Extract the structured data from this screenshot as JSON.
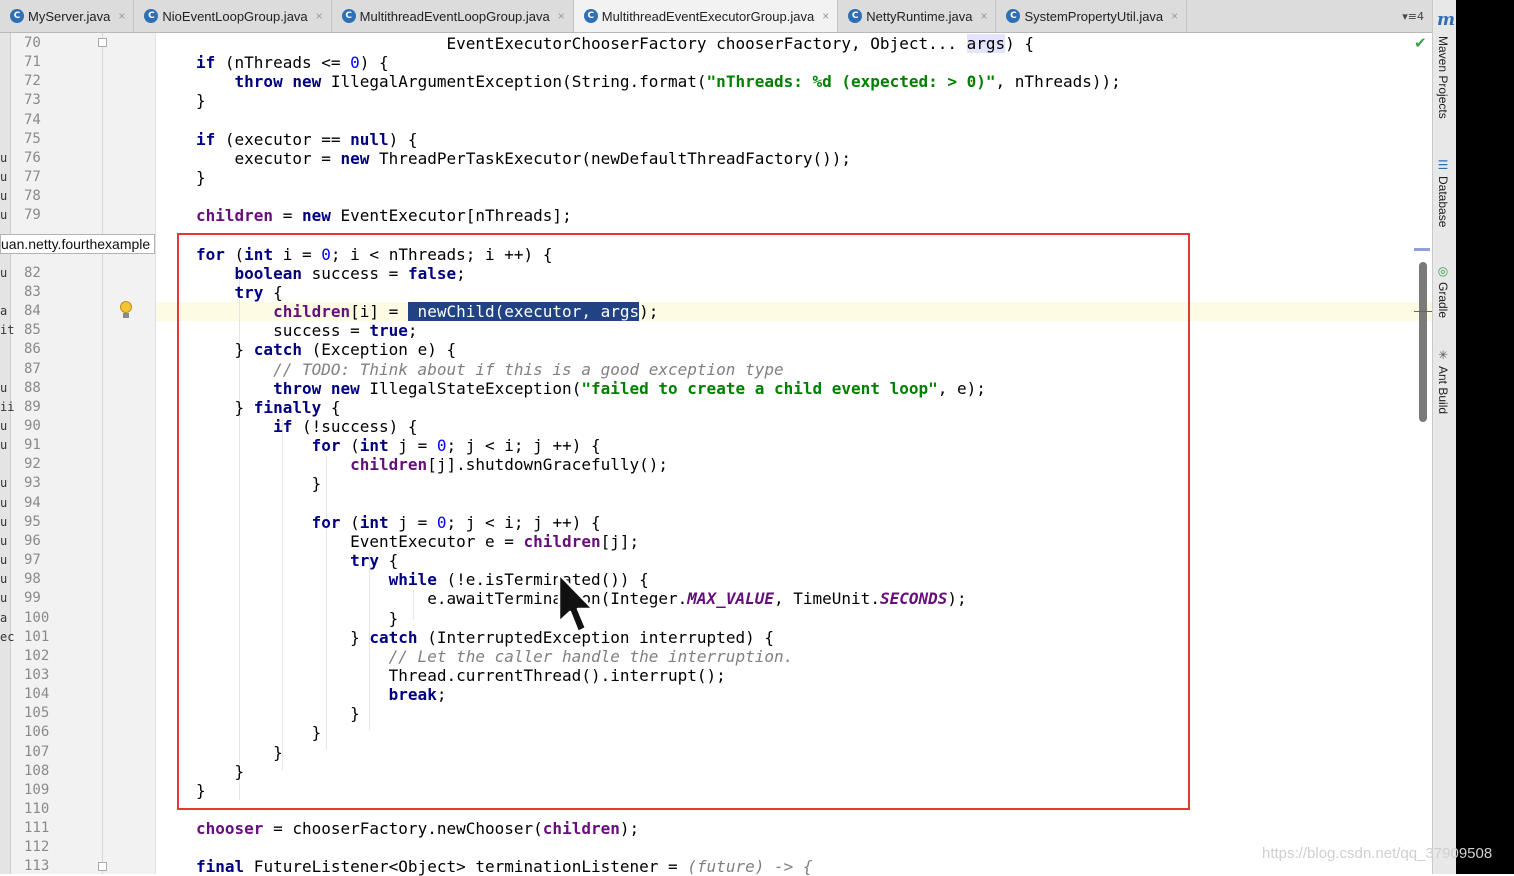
{
  "tabs": [
    {
      "label": "MyServer.java",
      "icon": "class-file-icon",
      "active": false
    },
    {
      "label": "NioEventLoopGroup.java",
      "icon": "class-file-icon",
      "active": false
    },
    {
      "label": "MultithreadEventLoopGroup.java",
      "icon": "class-file-icon",
      "active": false
    },
    {
      "label": "MultithreadEventExecutorGroup.java",
      "icon": "class-file-icon",
      "active": true
    },
    {
      "label": "NettyRuntime.java",
      "icon": "class-file-icon",
      "active": false
    },
    {
      "label": "SystemPropertyUtil.java",
      "icon": "class-file-icon",
      "active": false
    }
  ],
  "tab_overflow": "4",
  "tool_windows": [
    "Maven Projects",
    "Database",
    "Gradle",
    "Ant Build"
  ],
  "package_tooltip": "uan.netty.fourthexample",
  "gutter_left_chars": {
    "76": "u",
    "77": "u",
    "78": "u",
    "79": "u",
    "82": "u",
    "84": "a",
    "85": "it",
    "88": "u",
    "89": "ii",
    "90": "u",
    "91": "u",
    "93": "u",
    "94": "u",
    "95": "u",
    "96": "u",
    "97": "u",
    "98": "u",
    "99": "u",
    "100": "a",
    "101": "ec"
  },
  "code_lines": [
    {
      "n": "70",
      "html": "                          EventExecutorChooserFactory chooserFactory, Object... <span class=\"argsbg\">args</span>) {"
    },
    {
      "n": "71",
      "html": "<span class=\"kw\">if</span> (nThreads &lt;= <span class=\"num\">0</span>) {"
    },
    {
      "n": "72",
      "html": "    <span class=\"kw\">throw new</span> IllegalArgumentException(String.format(<span class=\"str\">\"nThreads: %d (expected: &gt; 0)\"</span>, nThreads));"
    },
    {
      "n": "73",
      "html": "}"
    },
    {
      "n": "74",
      "html": ""
    },
    {
      "n": "75",
      "html": "<span class=\"kw\">if</span> (executor == <span class=\"kw\">null</span>) {"
    },
    {
      "n": "76",
      "html": "    executor = <span class=\"kw\">new</span> ThreadPerTaskExecutor(newDefaultThreadFactory());"
    },
    {
      "n": "77",
      "html": "}"
    },
    {
      "n": "78",
      "html": ""
    },
    {
      "n": "79",
      "html": "<span class=\"fld\">children</span> = <span class=\"kw\">new</span> EventExecutor[nThreads];"
    },
    {
      "n": "",
      "html": ""
    },
    {
      "n": "",
      "html": "<span class=\"kw\">for</span> (<span class=\"kw\">int</span> i = <span class=\"num\">0</span>; i &lt; nThreads; i ++) {"
    },
    {
      "n": "82",
      "html": "    <span class=\"kw\">boolean</span> success = <span class=\"kw\">false</span>;"
    },
    {
      "n": "83",
      "html": "    <span class=\"kw\">try</span> {"
    },
    {
      "n": "84",
      "html": "        <span class=\"fld\">children</span>[i] = <span class=\"sel\"> newChild(executor, args</span>);"
    },
    {
      "n": "85",
      "html": "        success = <span class=\"kw\">true</span>;"
    },
    {
      "n": "86",
      "html": "    } <span class=\"kw\">catch</span> (Exception e) {"
    },
    {
      "n": "87",
      "html": "        <span class=\"cm\">// TODO: Think about if this is a good exception type</span>"
    },
    {
      "n": "88",
      "html": "        <span class=\"kw\">throw new</span> IllegalStateException(<span class=\"str\">\"failed to create a child event loop\"</span>, e);"
    },
    {
      "n": "89",
      "html": "    } <span class=\"kw\">finally</span> {"
    },
    {
      "n": "90",
      "html": "        <span class=\"kw\">if</span> (!success) {"
    },
    {
      "n": "91",
      "html": "            <span class=\"kw\">for</span> (<span class=\"kw\">int</span> j = <span class=\"num\">0</span>; j &lt; i; j ++) {"
    },
    {
      "n": "92",
      "html": "                <span class=\"fld\">children</span>[j].shutdownGracefully();"
    },
    {
      "n": "93",
      "html": "            }"
    },
    {
      "n": "94",
      "html": ""
    },
    {
      "n": "95",
      "html": "            <span class=\"kw\">for</span> (<span class=\"kw\">int</span> j = <span class=\"num\">0</span>; j &lt; i; j ++) {"
    },
    {
      "n": "96",
      "html": "                EventExecutor e = <span class=\"fld\">children</span>[j];"
    },
    {
      "n": "97",
      "html": "                <span class=\"kw\">try</span> {"
    },
    {
      "n": "98",
      "html": "                    <span class=\"kw\">while</span> (!e.isTerminated()) {"
    },
    {
      "n": "99",
      "html": "                        e.awaitTermination(Integer.<span class=\"cs\">MAX_VALUE</span>, TimeUnit.<span class=\"cs\">SECONDS</span>);"
    },
    {
      "n": "100",
      "html": "                    }"
    },
    {
      "n": "101",
      "html": "                } <span class=\"kw\">catch</span> (InterruptedException interrupted) {"
    },
    {
      "n": "102",
      "html": "                    <span class=\"cm\">// Let the caller handle the interruption.</span>"
    },
    {
      "n": "103",
      "html": "                    Thread.currentThread().interrupt();"
    },
    {
      "n": "104",
      "html": "                    <span class=\"kw\">break</span>;"
    },
    {
      "n": "105",
      "html": "                }"
    },
    {
      "n": "106",
      "html": "            }"
    },
    {
      "n": "107",
      "html": "        }"
    },
    {
      "n": "108",
      "html": "    }"
    },
    {
      "n": "109",
      "html": "}"
    },
    {
      "n": "110",
      "html": ""
    },
    {
      "n": "111",
      "html": "<span class=\"fld\">chooser</span> = chooserFactory.newChooser(<span class=\"fld\">children</span>);"
    },
    {
      "n": "112",
      "html": ""
    },
    {
      "n": "113",
      "html": "<span class=\"kw\">final</span> FutureListener&lt;Object&gt; terminationListener = <span class=\"cm\">(future) -&gt; {</span>"
    }
  ],
  "watermark": "https://blog.csdn.net/qq_37909508",
  "colors": {
    "keyword": "#000080",
    "field": "#660e7a",
    "string": "#008000",
    "number": "#0000ff",
    "comment": "#808080",
    "selection": "#214283",
    "highlight_box": "#e53935"
  }
}
